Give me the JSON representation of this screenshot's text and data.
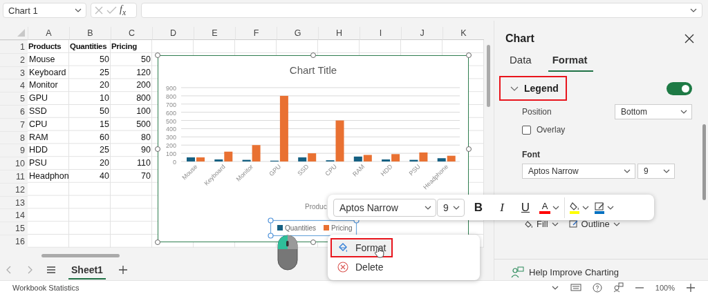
{
  "name_box": "Chart 1",
  "formula_fx": "f$_{x}$",
  "sheet": {
    "columns": [
      "A",
      "B",
      "C",
      "D",
      "E",
      "F",
      "G",
      "H",
      "I",
      "J",
      "K"
    ],
    "rows": [
      {
        "number": "1",
        "bold": true,
        "cells": [
          "Products",
          "Quantities",
          "Pricing"
        ]
      },
      {
        "number": "2",
        "bold": false,
        "cells": [
          "Mouse",
          "50",
          "50"
        ]
      },
      {
        "number": "3",
        "bold": false,
        "cells": [
          "Keyboard",
          "25",
          "120"
        ]
      },
      {
        "number": "4",
        "bold": false,
        "cells": [
          "Monitor",
          "20",
          "200"
        ]
      },
      {
        "number": "5",
        "bold": false,
        "cells": [
          "GPU",
          "10",
          "800"
        ]
      },
      {
        "number": "6",
        "bold": false,
        "cells": [
          "SSD",
          "50",
          "100"
        ]
      },
      {
        "number": "7",
        "bold": false,
        "cells": [
          "CPU",
          "15",
          "500"
        ]
      },
      {
        "number": "8",
        "bold": false,
        "cells": [
          "RAM",
          "60",
          "80"
        ]
      },
      {
        "number": "9",
        "bold": false,
        "cells": [
          "HDD",
          "25",
          "90"
        ]
      },
      {
        "number": "10",
        "bold": false,
        "cells": [
          "PSU",
          "20",
          "110"
        ]
      },
      {
        "number": "11",
        "bold": false,
        "cells": [
          "Headphon",
          "40",
          "70"
        ]
      },
      {
        "number": "12"
      },
      {
        "number": "13"
      },
      {
        "number": "14"
      },
      {
        "number": "15"
      },
      {
        "number": "16"
      }
    ]
  },
  "chart": {
    "chart_data": {
      "type": "bar",
      "title": "Chart Title",
      "xlabel": "Produc",
      "categories": [
        "Mouse",
        "Keyboard",
        "Monitor",
        "GPU",
        "SSD",
        "CPU",
        "RAM",
        "HDD",
        "PSU",
        "Headphone"
      ],
      "series": [
        {
          "name": "Quantities",
          "color": "#156082",
          "values": [
            50,
            25,
            20,
            10,
            50,
            15,
            60,
            25,
            20,
            40
          ]
        },
        {
          "name": "Pricing",
          "color": "#e97132",
          "values": [
            50,
            120,
            200,
            800,
            100,
            500,
            80,
            90,
            110,
            70
          ]
        }
      ],
      "ylim": [
        0,
        900
      ],
      "yticks": [
        {
          "value": 0,
          "label": "0"
        },
        {
          "value": 100,
          "label": "100"
        },
        {
          "value": 200,
          "label": "200"
        },
        {
          "value": 300,
          "label": "300"
        },
        {
          "value": 400,
          "label": "400"
        },
        {
          "value": 500,
          "label": "500"
        },
        {
          "value": 600,
          "label": "600"
        },
        {
          "value": 700,
          "label": "700"
        },
        {
          "value": 800,
          "label": "800"
        },
        {
          "value": 900,
          "label": "900"
        }
      ],
      "grid": true,
      "legend": true
    }
  },
  "sheet_tabs": [
    {
      "label": "Sheet1",
      "selected": true
    }
  ],
  "toolbar": {
    "font": "Aptos Narrow",
    "size": "9",
    "buttons": [
      {
        "kind": "bold",
        "label": "B"
      },
      {
        "kind": "italic",
        "label": "I"
      },
      {
        "kind": "underline",
        "label": "U"
      },
      {
        "kind": "font-color",
        "label": "A",
        "color": "#ff0000"
      },
      {
        "kind": "fill-color",
        "color": "#ffff00"
      },
      {
        "kind": "line-color",
        "color": "#0070c0"
      }
    ]
  },
  "context_menu": [
    {
      "kind": "format",
      "label": "Format",
      "highlighted": true
    },
    {
      "kind": "delete",
      "label": "Delete",
      "highlighted": false
    }
  ],
  "panel": {
    "title": "Chart",
    "tabs": [
      {
        "label": "Data",
        "selected": false
      },
      {
        "label": "Format",
        "selected": true
      }
    ],
    "section": {
      "title": "Legend",
      "expanded": true,
      "highlighted": true,
      "on": true,
      "position_label": "Position",
      "position": "Bottom",
      "overlay_label": "Overlay",
      "overlay": false,
      "font_label": "Font",
      "font": "Aptos Narrow",
      "size": "9"
    },
    "fill": "Fill",
    "outline": "Outline",
    "help": "Help Improve Charting"
  },
  "status_bar": {
    "left": "Workbook Statistics",
    "zoom": "100%"
  }
}
